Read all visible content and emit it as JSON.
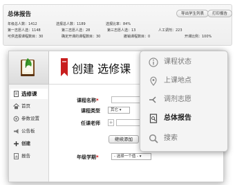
{
  "report": {
    "title": "总体报告",
    "export_button": "导出学生列表",
    "print_button": "打印报告",
    "stats": [
      [
        "年级总人数：1412",
        "选报总人数：1189",
        "选报比率：84%"
      ],
      [
        "第一志愿人选：1148",
        "第二志愿人选：28",
        "第三志愿人选：13",
        "人工调剂：223"
      ],
      [
        "可供选报课程数目：30",
        "确定开课的课程数目：30",
        "撤销课程数目：0",
        "开课比例：100%"
      ]
    ]
  },
  "header": {
    "title": "创建 选修课"
  },
  "sidebar": {
    "items": [
      {
        "label": "选修课",
        "icon": "document-icon"
      },
      {
        "label": "首页",
        "icon": "home-icon"
      },
      {
        "label": "参数设置",
        "icon": "settings-icon"
      },
      {
        "label": "公告板",
        "icon": "megaphone-icon"
      },
      {
        "label": "创建",
        "icon": "plus-icon"
      },
      {
        "label": "报告",
        "icon": "report-icon"
      }
    ]
  },
  "form": {
    "course_name_label": "课程名称",
    "required_mark": "*",
    "course_type_label": "课程类型",
    "course_type_value": "其它  ▾",
    "teacher_label": "任课老师",
    "plus_symbol": "+",
    "add_teacher_button": "继续添加",
    "grade_term_label": "年级学期",
    "grade_term_select": "- 选择一个值 -  ▾"
  },
  "menu": {
    "items": [
      {
        "label": "课程状态",
        "icon": "info-icon"
      },
      {
        "label": "上课地点",
        "icon": "location-pin-icon"
      },
      {
        "label": "调剂志愿",
        "icon": "adjust-icon"
      },
      {
        "label": "总体报告",
        "icon": "report-icon"
      },
      {
        "label": "搜索",
        "icon": "search-icon"
      }
    ]
  },
  "colors": {
    "accent_red": "#c81e1e",
    "required": "#d00000",
    "sidebar_bg": "#f3f3f3",
    "menu_bg": "#f4f4f4"
  }
}
